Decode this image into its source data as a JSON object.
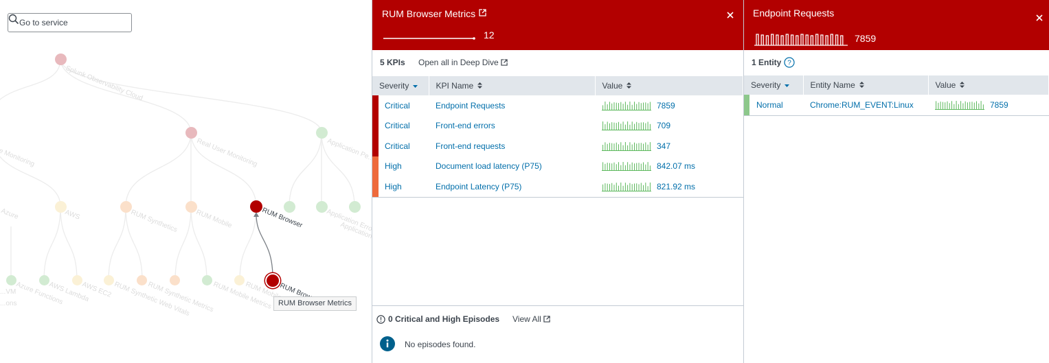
{
  "search": {
    "placeholder": "Go to service"
  },
  "tree": {
    "tooltip": "RUM Browser Metrics",
    "nodes": [
      {
        "label": "Splunk Observability Cloud",
        "color": "#e8b9bd"
      },
      {
        "label": "Real User Monitoring",
        "color": "#e8b9bd"
      },
      {
        "label": "Application Pe...",
        "color": "#d2ebd2"
      },
      {
        "label": "...re Monitoring",
        "color": "#fff"
      },
      {
        "label": "Azure",
        "color": "#fbf1d6"
      },
      {
        "label": "AWS",
        "color": "#fbf1d6"
      },
      {
        "label": "RUM Synthetics",
        "color": "#fbe0ca"
      },
      {
        "label": "RUM Mobile",
        "color": "#fbe0ca"
      },
      {
        "label": "RUM Browser",
        "color": "#b20000"
      },
      {
        "label": "Application Erro...",
        "color": "#d2ebd2"
      },
      {
        "label": "Application Rate (Throughp...",
        "color": "#d2ebd2"
      },
      {
        "label": "...VM",
        "color": "#fff"
      },
      {
        "label": "Azure Functions",
        "color": "#d2ebd2"
      },
      {
        "label": "AWS Lambda",
        "color": "#d2ebd2"
      },
      {
        "label": "AWS EC2",
        "color": "#fbf1d6"
      },
      {
        "label": "RUM Synthetic Web Vitals",
        "color": "#fbe0ca"
      },
      {
        "label": "RUM Synthetic Metrics",
        "color": "#fbe0ca"
      },
      {
        "label": "RUM Mobile Metrics",
        "color": "#d2ebd2"
      },
      {
        "label": "RUM Mobile App M...",
        "color": "#fbf1d6"
      },
      {
        "label": "RUM Browser Metrics",
        "color": "#b20000"
      },
      {
        "label": "...ons",
        "color": "#fff"
      }
    ]
  },
  "rum_panel": {
    "title": "RUM Browser Metrics",
    "value": "12",
    "kpi_count": "5 KPIs",
    "open_all": "Open all in Deep Dive",
    "columns": [
      "Severity",
      "KPI Name",
      "Value"
    ],
    "rows": [
      {
        "severity": "Critical",
        "name": "Endpoint Requests",
        "value": "7859",
        "color": "#b20000"
      },
      {
        "severity": "Critical",
        "name": "Front-end errors",
        "value": "709",
        "color": "#b20000"
      },
      {
        "severity": "Critical",
        "name": "Front-end requests",
        "value": "347",
        "color": "#b20000"
      },
      {
        "severity": "High",
        "name": "Document load latency (P75)",
        "value": "842.07 ms",
        "color": "#ee6a3c"
      },
      {
        "severity": "High",
        "name": "Endpoint Latency (P75)",
        "value": "821.92 ms",
        "color": "#ee6a3c"
      }
    ],
    "episodes_title": "0 Critical and High Episodes",
    "view_all": "View All",
    "no_episodes": "No episodes found."
  },
  "ep_panel": {
    "title": "Endpoint Requests",
    "value": "7859",
    "entity_count": "1 Entity",
    "columns": [
      "Severity",
      "Entity Name",
      "Value"
    ],
    "rows": [
      {
        "severity": "Normal",
        "name": "Chrome:RUM_EVENT:Linux",
        "value": "7859",
        "color": "#8dc88b"
      }
    ]
  },
  "colors": {
    "critical": "#b20000",
    "high": "#ee6a3c",
    "normal": "#8dc88b",
    "link": "#006eaa",
    "spark": "#5cb85c"
  }
}
